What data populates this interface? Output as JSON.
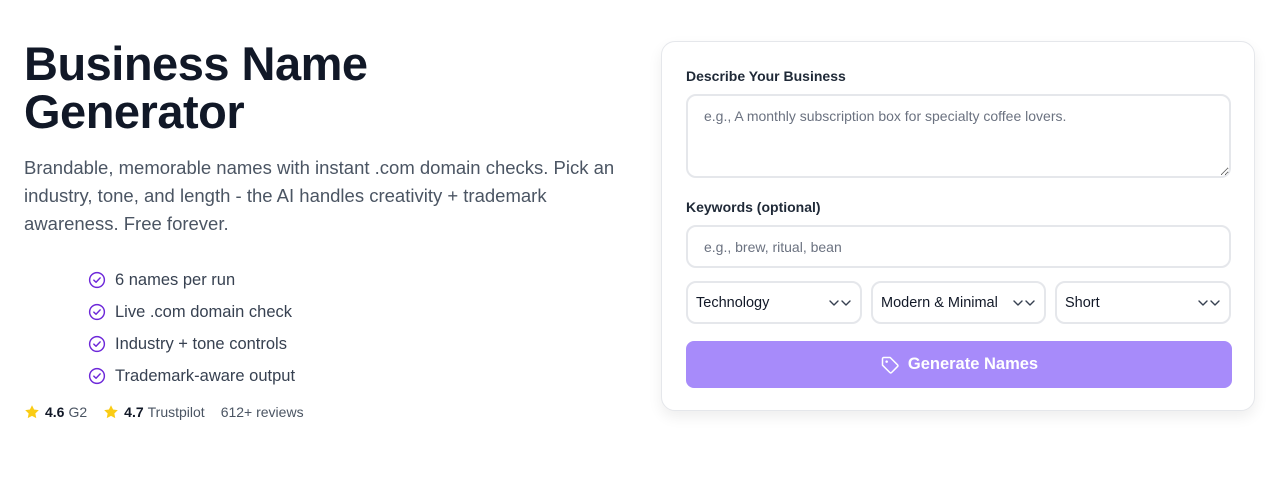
{
  "hero": {
    "title": "Business Name Generator",
    "description": "Brandable, memorable names with instant .com domain checks. Pick an industry, tone, and length - the AI handles creativity + trademark awareness. Free forever.",
    "features": [
      "6 names per run",
      "Live .com domain check",
      "Industry + tone controls",
      "Trademark-aware output"
    ]
  },
  "ratings": {
    "g2_score": "4.6",
    "g2_label": "G2",
    "trustpilot_score": "4.7",
    "trustpilot_label": "Trustpilot",
    "reviews": "612+ reviews",
    "star_color": "#facc15",
    "star_icon": "star-icon"
  },
  "form": {
    "describe_label": "Describe Your Business",
    "describe_placeholder": "e.g., A monthly subscription box for specialty coffee lovers.",
    "describe_value": "",
    "keywords_label": "Keywords (optional)",
    "keywords_placeholder": "e.g., brew, ritual, bean",
    "keywords_value": "",
    "industry_value": "Technology",
    "tone_value": "Modern & Minimal",
    "length_value": "Short",
    "generate_label": "Generate Names",
    "generate_icon": "tag-icon",
    "accent_color": "#a78bfa",
    "check_color": "#6d28d9"
  }
}
